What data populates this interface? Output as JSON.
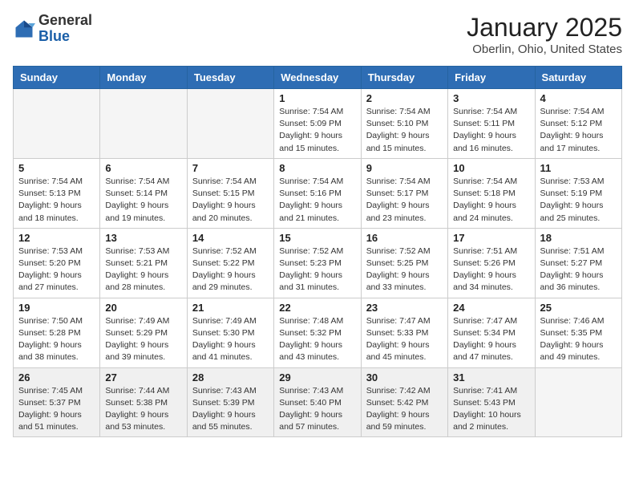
{
  "header": {
    "logo_general": "General",
    "logo_blue": "Blue",
    "month_title": "January 2025",
    "location": "Oberlin, Ohio, United States"
  },
  "days_of_week": [
    "Sunday",
    "Monday",
    "Tuesday",
    "Wednesday",
    "Thursday",
    "Friday",
    "Saturday"
  ],
  "weeks": [
    [
      {
        "day": "",
        "info": "",
        "empty": true
      },
      {
        "day": "",
        "info": "",
        "empty": true
      },
      {
        "day": "",
        "info": "",
        "empty": true
      },
      {
        "day": "1",
        "info": "Sunrise: 7:54 AM\nSunset: 5:09 PM\nDaylight: 9 hours\nand 15 minutes.",
        "empty": false
      },
      {
        "day": "2",
        "info": "Sunrise: 7:54 AM\nSunset: 5:10 PM\nDaylight: 9 hours\nand 15 minutes.",
        "empty": false
      },
      {
        "day": "3",
        "info": "Sunrise: 7:54 AM\nSunset: 5:11 PM\nDaylight: 9 hours\nand 16 minutes.",
        "empty": false
      },
      {
        "day": "4",
        "info": "Sunrise: 7:54 AM\nSunset: 5:12 PM\nDaylight: 9 hours\nand 17 minutes.",
        "empty": false
      }
    ],
    [
      {
        "day": "5",
        "info": "Sunrise: 7:54 AM\nSunset: 5:13 PM\nDaylight: 9 hours\nand 18 minutes.",
        "empty": false
      },
      {
        "day": "6",
        "info": "Sunrise: 7:54 AM\nSunset: 5:14 PM\nDaylight: 9 hours\nand 19 minutes.",
        "empty": false
      },
      {
        "day": "7",
        "info": "Sunrise: 7:54 AM\nSunset: 5:15 PM\nDaylight: 9 hours\nand 20 minutes.",
        "empty": false
      },
      {
        "day": "8",
        "info": "Sunrise: 7:54 AM\nSunset: 5:16 PM\nDaylight: 9 hours\nand 21 minutes.",
        "empty": false
      },
      {
        "day": "9",
        "info": "Sunrise: 7:54 AM\nSunset: 5:17 PM\nDaylight: 9 hours\nand 23 minutes.",
        "empty": false
      },
      {
        "day": "10",
        "info": "Sunrise: 7:54 AM\nSunset: 5:18 PM\nDaylight: 9 hours\nand 24 minutes.",
        "empty": false
      },
      {
        "day": "11",
        "info": "Sunrise: 7:53 AM\nSunset: 5:19 PM\nDaylight: 9 hours\nand 25 minutes.",
        "empty": false
      }
    ],
    [
      {
        "day": "12",
        "info": "Sunrise: 7:53 AM\nSunset: 5:20 PM\nDaylight: 9 hours\nand 27 minutes.",
        "empty": false
      },
      {
        "day": "13",
        "info": "Sunrise: 7:53 AM\nSunset: 5:21 PM\nDaylight: 9 hours\nand 28 minutes.",
        "empty": false
      },
      {
        "day": "14",
        "info": "Sunrise: 7:52 AM\nSunset: 5:22 PM\nDaylight: 9 hours\nand 29 minutes.",
        "empty": false
      },
      {
        "day": "15",
        "info": "Sunrise: 7:52 AM\nSunset: 5:23 PM\nDaylight: 9 hours\nand 31 minutes.",
        "empty": false
      },
      {
        "day": "16",
        "info": "Sunrise: 7:52 AM\nSunset: 5:25 PM\nDaylight: 9 hours\nand 33 minutes.",
        "empty": false
      },
      {
        "day": "17",
        "info": "Sunrise: 7:51 AM\nSunset: 5:26 PM\nDaylight: 9 hours\nand 34 minutes.",
        "empty": false
      },
      {
        "day": "18",
        "info": "Sunrise: 7:51 AM\nSunset: 5:27 PM\nDaylight: 9 hours\nand 36 minutes.",
        "empty": false
      }
    ],
    [
      {
        "day": "19",
        "info": "Sunrise: 7:50 AM\nSunset: 5:28 PM\nDaylight: 9 hours\nand 38 minutes.",
        "empty": false
      },
      {
        "day": "20",
        "info": "Sunrise: 7:49 AM\nSunset: 5:29 PM\nDaylight: 9 hours\nand 39 minutes.",
        "empty": false
      },
      {
        "day": "21",
        "info": "Sunrise: 7:49 AM\nSunset: 5:30 PM\nDaylight: 9 hours\nand 41 minutes.",
        "empty": false
      },
      {
        "day": "22",
        "info": "Sunrise: 7:48 AM\nSunset: 5:32 PM\nDaylight: 9 hours\nand 43 minutes.",
        "empty": false
      },
      {
        "day": "23",
        "info": "Sunrise: 7:47 AM\nSunset: 5:33 PM\nDaylight: 9 hours\nand 45 minutes.",
        "empty": false
      },
      {
        "day": "24",
        "info": "Sunrise: 7:47 AM\nSunset: 5:34 PM\nDaylight: 9 hours\nand 47 minutes.",
        "empty": false
      },
      {
        "day": "25",
        "info": "Sunrise: 7:46 AM\nSunset: 5:35 PM\nDaylight: 9 hours\nand 49 minutes.",
        "empty": false
      }
    ],
    [
      {
        "day": "26",
        "info": "Sunrise: 7:45 AM\nSunset: 5:37 PM\nDaylight: 9 hours\nand 51 minutes.",
        "empty": false
      },
      {
        "day": "27",
        "info": "Sunrise: 7:44 AM\nSunset: 5:38 PM\nDaylight: 9 hours\nand 53 minutes.",
        "empty": false
      },
      {
        "day": "28",
        "info": "Sunrise: 7:43 AM\nSunset: 5:39 PM\nDaylight: 9 hours\nand 55 minutes.",
        "empty": false
      },
      {
        "day": "29",
        "info": "Sunrise: 7:43 AM\nSunset: 5:40 PM\nDaylight: 9 hours\nand 57 minutes.",
        "empty": false
      },
      {
        "day": "30",
        "info": "Sunrise: 7:42 AM\nSunset: 5:42 PM\nDaylight: 9 hours\nand 59 minutes.",
        "empty": false
      },
      {
        "day": "31",
        "info": "Sunrise: 7:41 AM\nSunset: 5:43 PM\nDaylight: 10 hours\nand 2 minutes.",
        "empty": false
      },
      {
        "day": "",
        "info": "",
        "empty": true
      }
    ]
  ]
}
